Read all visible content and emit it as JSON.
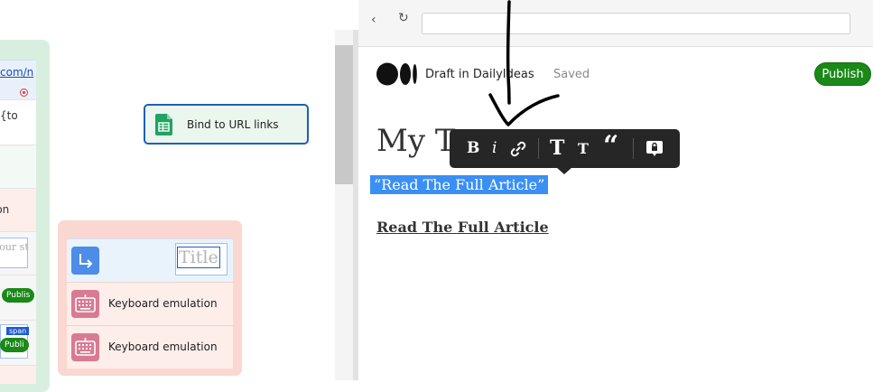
{
  "left_panel": {
    "url_fragment": "com/n",
    "code_fragment": "{to",
    "action_fragment": "ion",
    "input_placeholder": "your st",
    "publish_fragment_1": "Publis",
    "publish_fragment_2": "Publi",
    "span_tag": "span"
  },
  "bind_card": {
    "label": "Bind to URL links",
    "icon": "google-sheets-icon"
  },
  "red_group": {
    "row1_icon": "redirect-arrow-icon",
    "title_preview": "Title",
    "row2_label": "Keyboard emulation",
    "row3_label": "Keyboard emulation",
    "keyboard_icon": "keyboard-icon"
  },
  "editor": {
    "draft_label": "Draft in DailyIdeas",
    "saved_label": "Saved",
    "publish_label": "Publish",
    "title": "My T",
    "selected_quote": "“Read The Full Article”",
    "link_text": "Read The Full Article"
  },
  "format_toolbar": {
    "bold": "B",
    "italic": "i",
    "large_title": "T",
    "small_title": "T",
    "quote": "“"
  },
  "colors": {
    "publish_green": "#1a8917",
    "selection_blue": "#3a8ff5",
    "toolbar_dark": "#262626",
    "bind_border": "#1d5fb8"
  }
}
